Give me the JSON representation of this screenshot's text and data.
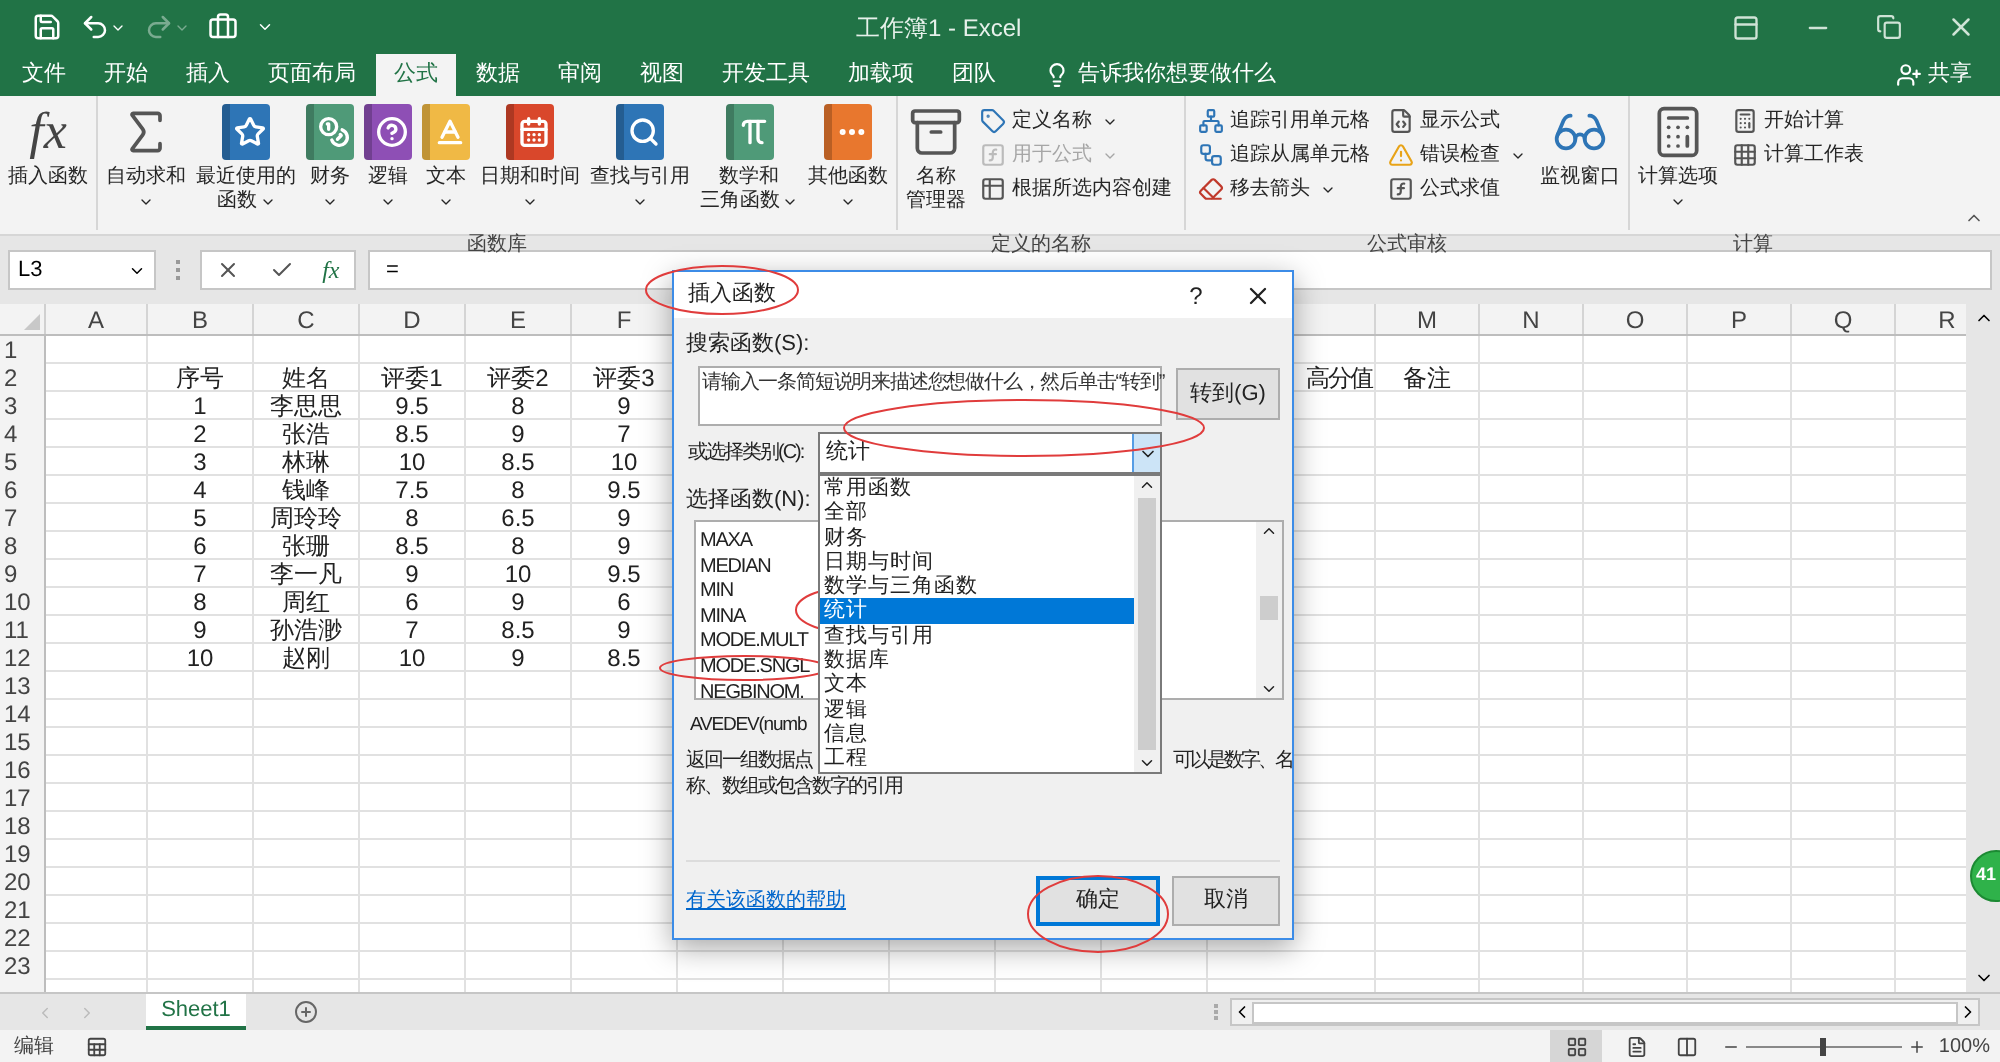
{
  "title_bar": {
    "title": "工作簿1 - Excel"
  },
  "tabs": [
    {
      "label": "文件",
      "selected": false
    },
    {
      "label": "开始",
      "selected": false
    },
    {
      "label": "插入",
      "selected": false
    },
    {
      "label": "页面布局",
      "selected": false
    },
    {
      "label": "公式",
      "selected": true
    },
    {
      "label": "数据",
      "selected": false
    },
    {
      "label": "审阅",
      "selected": false
    },
    {
      "label": "视图",
      "selected": false
    },
    {
      "label": "开发工具",
      "selected": false
    },
    {
      "label": "加载项",
      "selected": false
    },
    {
      "label": "团队",
      "selected": false
    }
  ],
  "tell_me": "告诉我你想要做什么",
  "share": "共享",
  "ribbon": [
    {
      "items": [
        {
          "kind": "large",
          "lines": [
            "插入函数"
          ],
          "glyph": "fx",
          "dropdown": false,
          "disabled": false
        }
      ]
    },
    {
      "label": "函数库",
      "items": [
        {
          "kind": "large",
          "lines": [
            "自动求和"
          ],
          "dropdown": true,
          "disabled": false
        },
        {
          "kind": "large",
          "lines": [
            "最近使用的",
            "函数"
          ],
          "dropdown": true,
          "disabled": false
        },
        {
          "kind": "large",
          "lines": [
            "财务"
          ],
          "dropdown": true,
          "disabled": false
        },
        {
          "kind": "large",
          "lines": [
            "逻辑"
          ],
          "dropdown": true,
          "disabled": false
        },
        {
          "kind": "large",
          "lines": [
            "文本"
          ],
          "dropdown": true,
          "disabled": false
        },
        {
          "kind": "large",
          "lines": [
            "日期和时间"
          ],
          "dropdown": true,
          "disabled": false
        },
        {
          "kind": "large",
          "lines": [
            "查找与引用"
          ],
          "dropdown": true,
          "disabled": false
        },
        {
          "kind": "large",
          "lines": [
            "数学和",
            "三角函数"
          ],
          "dropdown": true,
          "disabled": false
        },
        {
          "kind": "large",
          "lines": [
            "其他函数"
          ],
          "dropdown": true,
          "disabled": false
        }
      ]
    },
    {
      "label": "定义的名称",
      "items": [
        {
          "kind": "large",
          "lines": [
            "名称",
            "管理器"
          ],
          "dropdown": false,
          "disabled": false
        },
        {
          "kind": "small",
          "lines": [
            "定义名称"
          ],
          "dropdown": true,
          "disabled": false
        },
        {
          "kind": "small",
          "lines": [
            "用于公式"
          ],
          "dropdown": true,
          "disabled": true
        },
        {
          "kind": "small",
          "lines": [
            "根据所选内容创建"
          ],
          "dropdown": false,
          "disabled": false
        }
      ]
    },
    {
      "label": "公式审核",
      "items": [
        {
          "kind": "small",
          "lines": [
            "追踪引用单元格"
          ],
          "dropdown": false,
          "disabled": false
        },
        {
          "kind": "small",
          "lines": [
            "追踪从属单元格"
          ],
          "dropdown": false,
          "disabled": false
        },
        {
          "kind": "small",
          "lines": [
            "移去箭头"
          ],
          "dropdown": true,
          "disabled": false
        },
        {
          "kind": "small",
          "lines": [
            "显示公式"
          ],
          "dropdown": false,
          "disabled": false
        },
        {
          "kind": "small",
          "lines": [
            "错误检查"
          ],
          "dropdown": true,
          "disabled": false
        },
        {
          "kind": "small",
          "lines": [
            "公式求值"
          ],
          "dropdown": false,
          "disabled": false
        },
        {
          "kind": "large",
          "lines": [
            "监视窗口"
          ],
          "dropdown": false,
          "disabled": false
        }
      ]
    },
    {
      "label": "计算",
      "items": [
        {
          "kind": "large",
          "lines": [
            "计算选项"
          ],
          "dropdown": true,
          "disabled": false
        },
        {
          "kind": "small",
          "lines": [
            "开始计算"
          ],
          "dropdown": false,
          "disabled": false
        },
        {
          "kind": "small",
          "lines": [
            "计算工作表"
          ],
          "dropdown": false,
          "disabled": false
        }
      ]
    }
  ],
  "formula_bar": {
    "name_box": "L3",
    "fx_glyph": "fx",
    "formula": "="
  },
  "sheet": {
    "columns": [
      "A",
      "B",
      "C",
      "D",
      "E",
      "F",
      "M",
      "N",
      "O",
      "P",
      "Q",
      "R"
    ],
    "rows": [
      {
        "number": "1"
      },
      {
        "number": "2",
        "cells": {
          "B": "序号",
          "C": "姓名",
          "D": "评委1",
          "E": "评委2",
          "F": "评委3",
          "M": "备注"
        },
        "covered_text": "高分值"
      },
      {
        "number": "3",
        "cells": {
          "B": "1",
          "C": "李思思",
          "D": "9.5",
          "E": "8",
          "F": "9"
        }
      },
      {
        "number": "4",
        "cells": {
          "B": "2",
          "C": "张浩",
          "D": "8.5",
          "E": "9",
          "F": "7"
        }
      },
      {
        "number": "5",
        "cells": {
          "B": "3",
          "C": "林琳",
          "D": "10",
          "E": "8.5",
          "F": "10"
        }
      },
      {
        "number": "6",
        "cells": {
          "B": "4",
          "C": "钱峰",
          "D": "7.5",
          "E": "8",
          "F": "9.5"
        }
      },
      {
        "number": "7",
        "cells": {
          "B": "5",
          "C": "周玲玲",
          "D": "8",
          "E": "6.5",
          "F": "9"
        }
      },
      {
        "number": "8",
        "cells": {
          "B": "6",
          "C": "张珊",
          "D": "8.5",
          "E": "8",
          "F": "9"
        }
      },
      {
        "number": "9",
        "cells": {
          "B": "7",
          "C": "李一凡",
          "D": "9",
          "E": "10",
          "F": "9.5"
        }
      },
      {
        "number": "10",
        "cells": {
          "B": "8",
          "C": "周红",
          "D": "6",
          "E": "9",
          "F": "6"
        }
      },
      {
        "number": "11",
        "cells": {
          "B": "9",
          "C": "孙浩渺",
          "D": "7",
          "E": "8.5",
          "F": "9"
        }
      },
      {
        "number": "12",
        "cells": {
          "B": "10",
          "C": "赵刚",
          "D": "10",
          "E": "9",
          "F": "8.5"
        }
      },
      {
        "number": "13"
      },
      {
        "number": "14"
      },
      {
        "number": "15"
      },
      {
        "number": "16"
      },
      {
        "number": "17"
      },
      {
        "number": "18"
      },
      {
        "number": "19"
      },
      {
        "number": "20"
      },
      {
        "number": "21"
      },
      {
        "number": "22"
      },
      {
        "number": "23"
      }
    ]
  },
  "dialog": {
    "title": "插入函数",
    "help_glyph": "?",
    "search_label": "搜索函数(S):",
    "search_value": "请输入一条简短说明来描述您想做什么，然后单击“转到”",
    "go_button": "转到(G)",
    "category_label": "或选择类别(C):",
    "category_value": "统计",
    "categories": [
      {
        "label": "常用函数",
        "selected": false
      },
      {
        "label": "全部",
        "selected": false
      },
      {
        "label": "财务",
        "selected": false
      },
      {
        "label": "日期与时间",
        "selected": false
      },
      {
        "label": "数学与三角函数",
        "selected": false
      },
      {
        "label": "统计",
        "selected": true
      },
      {
        "label": "查找与引用",
        "selected": false
      },
      {
        "label": "数据库",
        "selected": false
      },
      {
        "label": "文本",
        "selected": false
      },
      {
        "label": "逻辑",
        "selected": false
      },
      {
        "label": "信息",
        "selected": false
      },
      {
        "label": "工程",
        "selected": false
      }
    ],
    "function_label": "选择函数(N):",
    "functions": [
      "MAXA",
      "MEDIAN",
      "MIN",
      "MINA",
      "MODE.MULT",
      "MODE.SNGL",
      "NEGBINOM."
    ],
    "signature": "AVEDEV(numb",
    "description_parts": [
      "返回一组数据点",
      "可以是数字、名"
    ],
    "description_line2": "称、数组或包含数字的引用",
    "help_link": "有关该函数的帮助",
    "ok_button": "确定",
    "cancel_button": "取消"
  },
  "sheet_tabs": [
    {
      "label": "Sheet1",
      "selected": true
    }
  ],
  "status_bar": {
    "mode": "编辑",
    "zoom": "100%",
    "zoom_slider": {
      "level": 0.48
    }
  },
  "floating_badge": "41"
}
